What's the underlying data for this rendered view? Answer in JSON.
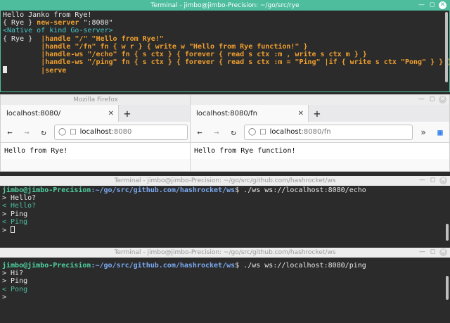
{
  "terminal_top": {
    "title": "Terminal - jimbo@jimbo-Precision: ~/go/src/rye",
    "line1": "Hello Janko from Rye!",
    "line2_prefix": "{ Rye } ",
    "line2_cmd": "new-server",
    "line2_arg": " \":8080\"",
    "line3": "<Native of kind Go-server>",
    "line4_prefix": "{ Rye }  ",
    "line4_code": "|handle \"/\" \"Hello from Rye!\"",
    "line5_code": "|handle \"/fn\" fn { w r } { write w \"Hello from Rye function!\" }",
    "line6_code": "|handle-ws \"/echo\" fn { s ctx } { forever { read s ctx :m , write s ctx m } }",
    "line7_code": "|handle-ws \"/ping\" fn { s ctx } { forever { read s ctx :m = \"Ping\" |if { write s ctx \"Pong\" } } }",
    "line8_code": "|serve"
  },
  "firefox_left": {
    "title": "Mozilla Firefox",
    "tab_label": "localhost:8080/",
    "url_host": "localhost",
    "url_path": ":8080",
    "content": "Hello from Rye!"
  },
  "firefox_right": {
    "tab_label": "localhost:8080/fn",
    "url_host": "localhost",
    "url_path": ":8080/fn",
    "content": "Hello from Rye function!"
  },
  "terminal_echo": {
    "title": "Terminal - jimbo@jimbo-Precision: ~/go/src/github.com/hashrocket/ws",
    "prompt_user": "jimbo@jimbo-Precision",
    "prompt_path": ":~/go/src/github.com/hashrocket/ws",
    "command": "$ ./ws ws://localhost:8080/echo",
    "lines": [
      "> Hello?",
      "< Hello?",
      "> Ping",
      "< Ping",
      ">"
    ]
  },
  "terminal_ping": {
    "title": "Terminal - jimbo@jimbo-Precision: ~/go/src/github.com/hashrocket/ws",
    "prompt_user": "jimbo@jimbo-Precision",
    "prompt_path": ":~/go/src/github.com/hashrocket/ws",
    "command": "$ ./ws ws://localhost:8080/ping",
    "lines": [
      "> Hi?",
      "> Ping",
      "< Pong",
      ">"
    ]
  },
  "colors": {
    "accent": "#4dbd9e",
    "terminal_bg": "#2b2b2b",
    "keyword": "#f0a030",
    "cyan": "#45c6c6"
  }
}
